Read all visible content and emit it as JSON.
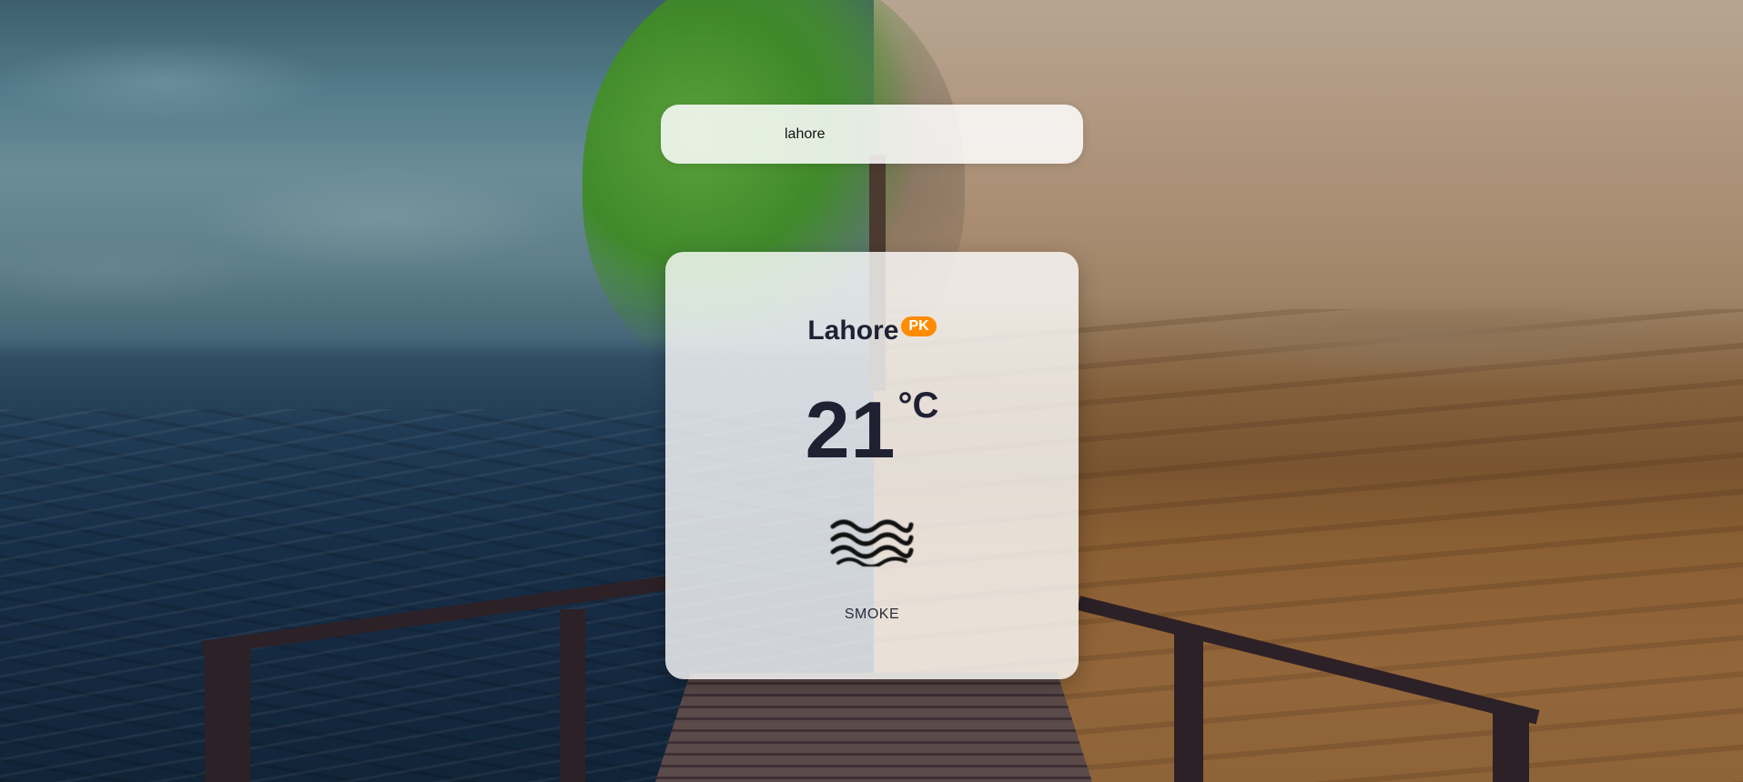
{
  "search": {
    "value": "lahore"
  },
  "weather": {
    "city": "Lahore",
    "country_code": "PK",
    "temperature": "21",
    "unit": "°C",
    "condition": "SMOKE",
    "icon": "haze-waves-icon"
  },
  "colors": {
    "badge_background": "#ff8c00",
    "text_primary": "#1f2133"
  }
}
